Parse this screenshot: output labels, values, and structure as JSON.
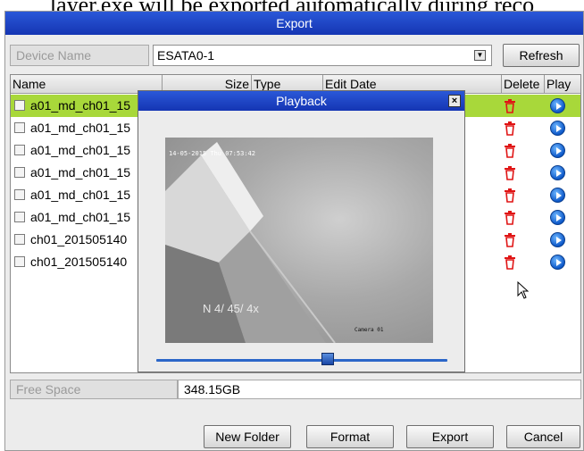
{
  "caption": "layer.exe will be exported automatically during reco",
  "window": {
    "title": "Export"
  },
  "device": {
    "label": "Device Name",
    "value": "ESATA0-1",
    "refresh_label": "Refresh"
  },
  "table": {
    "headers": {
      "name": "Name",
      "size": "Size",
      "type": "Type",
      "edit_date": "Edit Date",
      "delete": "Delete",
      "play": "Play"
    },
    "rows": [
      {
        "name": "a01_md_ch01_15",
        "selected": true
      },
      {
        "name": "a01_md_ch01_15",
        "selected": false
      },
      {
        "name": "a01_md_ch01_15",
        "selected": false
      },
      {
        "name": "a01_md_ch01_15",
        "selected": false
      },
      {
        "name": "a01_md_ch01_15",
        "selected": false
      },
      {
        "name": "a01_md_ch01_15",
        "selected": false
      },
      {
        "name": "ch01_201505140",
        "selected": false
      },
      {
        "name": "ch01_201505140",
        "selected": false
      }
    ]
  },
  "free_space": {
    "label": "Free Space",
    "value": "348.15GB"
  },
  "buttons": {
    "new_folder": "New Folder",
    "format": "Format",
    "export": "Export",
    "cancel": "Cancel"
  },
  "playback": {
    "title": "Playback",
    "close": "×",
    "osd_timestamp": "14-05-2015 Thu 07:53:42",
    "speed_indicator": "N    4/ 45/   4x",
    "camera_label": "Camera 01",
    "progress_fraction": 0.59
  },
  "colors": {
    "titlebar": "#1f46c9",
    "selected_row": "#a8d83a",
    "delete_icon": "#e01515",
    "play_icon": "#0d58c9"
  }
}
